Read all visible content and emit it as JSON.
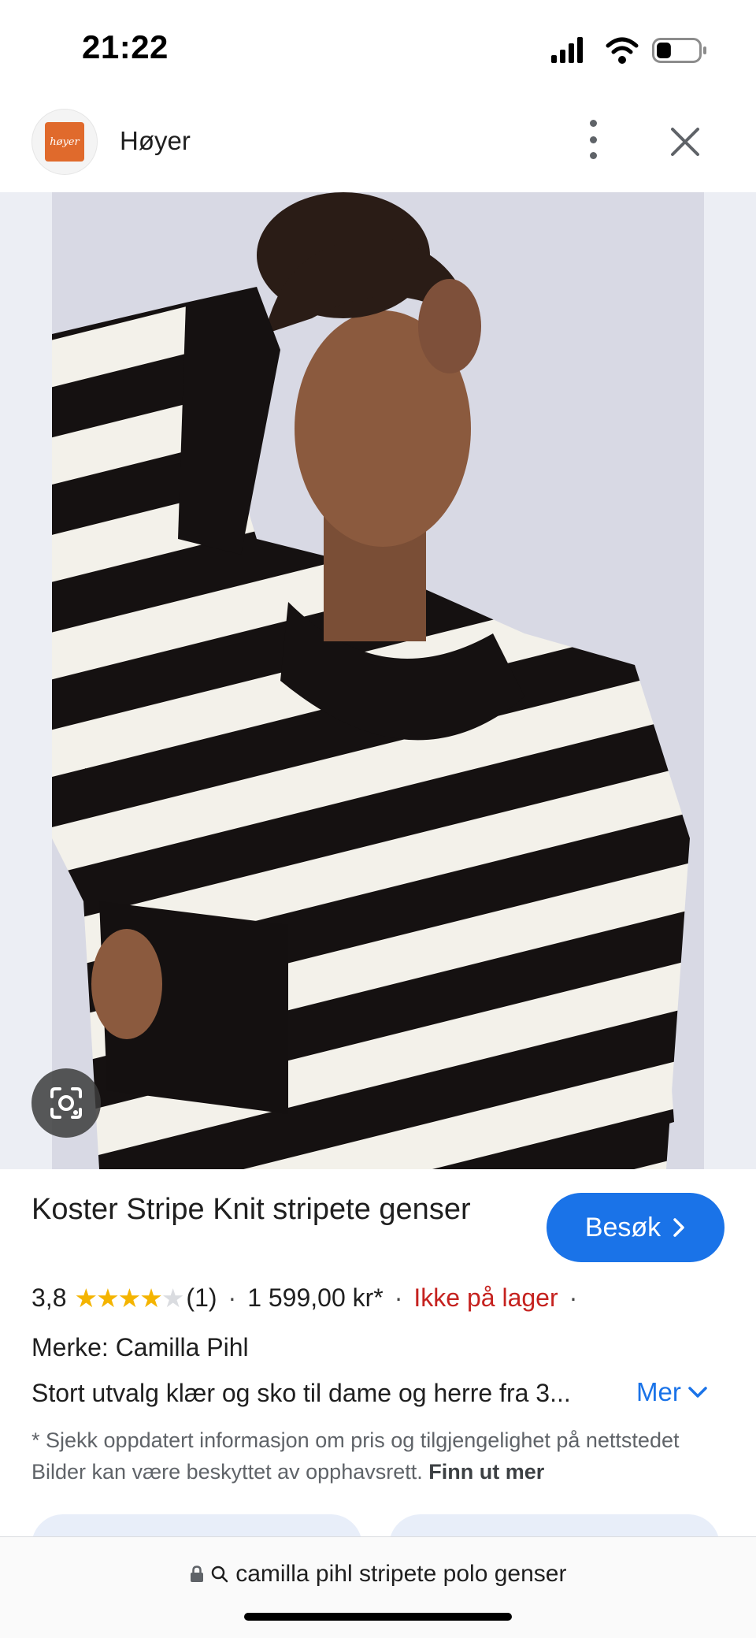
{
  "status_bar": {
    "time": "21:22",
    "battery_level": 0.35
  },
  "header": {
    "logo_text": "høyer",
    "site_name": "Høyer",
    "icons": {
      "menu": "more-vert-icon",
      "close": "close-icon"
    }
  },
  "image": {
    "alt": "lens-icon"
  },
  "product": {
    "title": "Koster Stripe Knit stripete genser",
    "visit_label": "Besøk",
    "rating": "3,8",
    "rating_value": 3.8,
    "review_count": "(1)",
    "price": "1 599,00 kr*",
    "stock": "Ikke på lager",
    "brand": "Merke: Camilla Pihl",
    "description": "Stort utvalg klær og sko til dame og herre fra 3...",
    "more_label": "Mer",
    "disclaimer_text": "* Sjekk oppdatert informasjon om pris og tilgjengelighet på nettstedet Bilder kan være beskyttet av opphavsrett.",
    "disclaimer_link": "Finn ut mer"
  },
  "url_bar": {
    "text": "camilla pihl stripete polo genser"
  },
  "colors": {
    "accent": "#1a73e8",
    "out_of_stock": "#c5221f",
    "star": "#f4b400"
  }
}
